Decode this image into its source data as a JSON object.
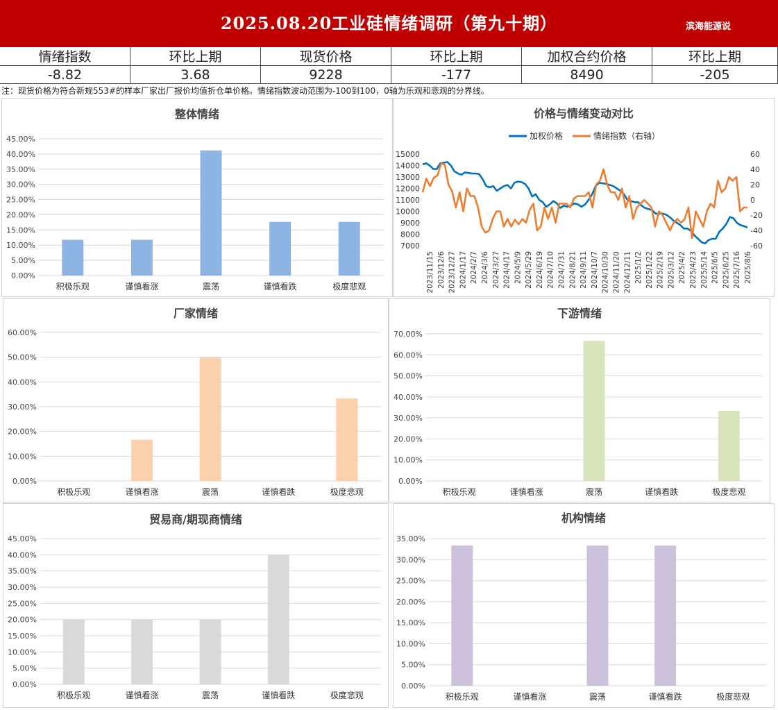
{
  "header": {
    "title": "2025.08.20工业硅情绪调研（第九十期）",
    "source": "滨海能源说",
    "bg_color": "#c00000"
  },
  "metrics": [
    {
      "label": "情绪指数",
      "value": "-8.82"
    },
    {
      "label": "环比上期",
      "value": "3.68"
    },
    {
      "label": "现货价格",
      "value": "9228"
    },
    {
      "label": "环比上期",
      "value": "-177"
    },
    {
      "label": "加权合约价格",
      "value": "8490"
    },
    {
      "label": "环比上期",
      "value": "-205"
    }
  ],
  "note": "注：现货价格为符合新规553#的样本厂家出厂报价均值折仓单价格。情绪指数波动范围为-100到100，0轴为乐观和悲观的分界线。",
  "chart_data": [
    {
      "type": "bar",
      "title": "整体情绪",
      "color": "#8db4e2",
      "categories": [
        "积极乐观",
        "谨慎看涨",
        "震荡",
        "谨慎看跌",
        "极度悲观"
      ],
      "values": [
        11.76,
        11.76,
        41.18,
        17.65,
        17.65
      ],
      "ylim": [
        0,
        45
      ],
      "ytick_step": 5,
      "y_format": "percent",
      "grid": true
    },
    {
      "type": "line",
      "title": "价格与情绪变动对比",
      "legend_position": "top",
      "x_labels": [
        "2023/11/15",
        "2023/12/6",
        "2023/12/27",
        "2024/1/17",
        "2024/2/7",
        "2024/3/6",
        "2024/3/27",
        "2024/4/17",
        "2024/5/9",
        "2024/5/29",
        "2024/6/19",
        "2024/7/10",
        "2024/7/31",
        "2024/8/21",
        "2024/9/11",
        "2024/10/7",
        "2024/10/30",
        "2024/11/20",
        "2024/12/11",
        "2025/1/2",
        "2025/1/22",
        "2025/2/19",
        "2025/3/12",
        "2025/4/2",
        "2025/4/23",
        "2025/5/14",
        "2025/6/5",
        "2025/6/25",
        "2025/7/16",
        "2025/8/6"
      ],
      "series": [
        {
          "name": "加权价格",
          "axis": "left",
          "color": "#0070c0",
          "values": [
            14100,
            14200,
            14000,
            13700,
            13700,
            14200,
            14250,
            14300,
            14000,
            13500,
            13300,
            13200,
            13400,
            13350,
            13300,
            13300,
            13250,
            12800,
            12200,
            12100,
            12200,
            11800,
            12000,
            12200,
            12300,
            12000,
            12500,
            12600,
            12550,
            12400,
            12000,
            11300,
            11500,
            11000,
            10800,
            10400,
            10600,
            10900,
            10700,
            10300,
            10500,
            10400,
            10500,
            10700,
            10600,
            10400,
            10600,
            11000,
            11500,
            12200,
            12500,
            12450,
            12400,
            12300,
            12200,
            12000,
            11800,
            11500,
            11000,
            10900,
            10800,
            10800,
            10500,
            10300,
            10200,
            10100,
            9800,
            9800,
            9800,
            9700,
            9500,
            9200,
            9000,
            8800,
            8500,
            8500,
            8300,
            7900,
            7600,
            7300,
            7200,
            7500,
            7600,
            7600,
            8200,
            8500,
            8900,
            9500,
            9400,
            9000,
            8800,
            8700,
            8600
          ]
        },
        {
          "name": "情绪指数（右轴）",
          "axis": "right",
          "color": "#ed7d31",
          "values": [
            10,
            28,
            18,
            29,
            32,
            48,
            46,
            20,
            11,
            -10,
            10,
            -15,
            15,
            5,
            5,
            -10,
            -35,
            -43,
            -40,
            -25,
            -15,
            -15,
            -35,
            -25,
            -35,
            -26,
            -32,
            -25,
            -30,
            -13,
            -5,
            -40,
            -35,
            -10,
            -25,
            -10,
            -30,
            -5,
            -5,
            -5,
            -10,
            2,
            5,
            5,
            5,
            10,
            -10,
            20,
            25,
            40,
            20,
            10,
            10,
            0,
            15,
            -10,
            5,
            -25,
            -10,
            -5,
            0,
            -5,
            -10,
            -35,
            -15,
            -20,
            -30,
            -40,
            -30,
            -25,
            -30,
            -25,
            -10,
            -50,
            -15,
            -25,
            -35,
            -15,
            -5,
            -10,
            25,
            10,
            15,
            30,
            25,
            30,
            -15,
            -10,
            -10
          ]
        }
      ],
      "y_left": {
        "range": [
          7000,
          15000
        ],
        "ticks": [
          7000,
          8000,
          9000,
          10000,
          11000,
          12000,
          13000,
          14000,
          15000
        ]
      },
      "y_right": {
        "range": [
          -60,
          60
        ],
        "ticks": [
          -60,
          -40,
          -20,
          0,
          20,
          40,
          60
        ]
      }
    },
    {
      "type": "bar",
      "title": "厂家情绪",
      "color": "#fad0ad",
      "categories": [
        "积极乐观",
        "谨慎看涨",
        "震荡",
        "谨慎看跌",
        "极度悲观"
      ],
      "values": [
        0,
        16.67,
        50.0,
        0,
        33.33
      ],
      "ylim": [
        0,
        60
      ],
      "ytick_step": 10,
      "y_format": "percent",
      "grid": true
    },
    {
      "type": "bar",
      "title": "下游情绪",
      "color": "#d8e4bc",
      "categories": [
        "积极乐观",
        "谨慎看涨",
        "震荡",
        "谨慎看跌",
        "极度悲观"
      ],
      "values": [
        0,
        0,
        66.67,
        0,
        33.33
      ],
      "ylim": [
        0,
        70
      ],
      "ytick_step": 10,
      "y_format": "percent",
      "grid": true
    },
    {
      "type": "bar",
      "title": "贸易商/期现商情绪",
      "color": "#d9d9d9",
      "categories": [
        "积极乐观",
        "谨慎看涨",
        "震荡",
        "谨慎看跌",
        "极度悲观"
      ],
      "values": [
        20.0,
        20.0,
        20.0,
        40.0,
        0
      ],
      "ylim": [
        0,
        45
      ],
      "ytick_step": 5,
      "y_format": "percent",
      "grid": true
    },
    {
      "type": "bar",
      "title": "机构情绪",
      "color": "#ccc0da",
      "categories": [
        "积极乐观",
        "谨慎看涨",
        "震荡",
        "谨慎看跌",
        "极度悲观"
      ],
      "values": [
        33.33,
        0,
        33.33,
        33.33,
        0
      ],
      "ylim": [
        0,
        35
      ],
      "ytick_step": 5,
      "y_format": "percent",
      "grid": true
    }
  ]
}
